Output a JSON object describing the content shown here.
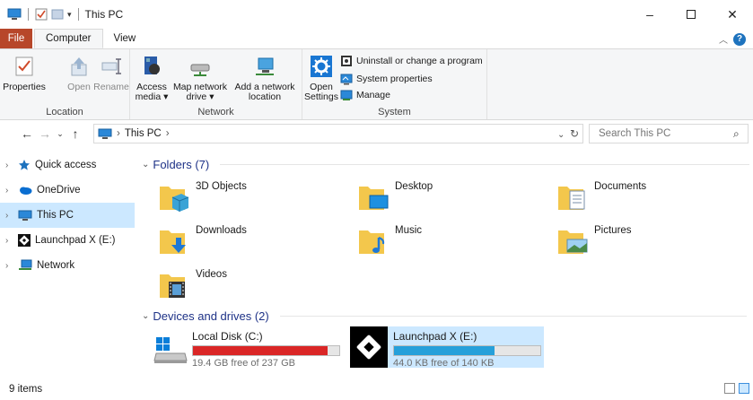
{
  "window": {
    "title": "This PC"
  },
  "ribbon_tabs": {
    "file": "File",
    "computer": "Computer",
    "view": "View"
  },
  "ribbon": {
    "location": {
      "label": "Location",
      "properties": "Properties",
      "open": "Open",
      "rename": "Rename"
    },
    "network": {
      "label": "Network",
      "access_media_1": "Access",
      "access_media_2": "media ▾",
      "map_drive_1": "Map network",
      "map_drive_2": "drive ▾",
      "add_location_1": "Add a network",
      "add_location_2": "location"
    },
    "system": {
      "label": "System",
      "open_settings_1": "Open",
      "open_settings_2": "Settings",
      "uninstall": "Uninstall or change a program",
      "system_properties": "System properties",
      "manage": "Manage"
    }
  },
  "address": {
    "crumb": "This PC",
    "chevron": "›"
  },
  "search": {
    "placeholder": "Search This PC"
  },
  "nav_pane": {
    "items": [
      {
        "label": "Quick access"
      },
      {
        "label": "OneDrive"
      },
      {
        "label": "This PC"
      },
      {
        "label": "Launchpad X (E:)"
      },
      {
        "label": "Network"
      }
    ]
  },
  "folders_section": {
    "title": "Folders (7)"
  },
  "folders": [
    "3D Objects",
    "Desktop",
    "Documents",
    "Downloads",
    "Music",
    "Pictures",
    "Videos"
  ],
  "drives_section": {
    "title": "Devices and drives (2)"
  },
  "drives": [
    {
      "name": "Local Disk (C:)",
      "free_text": "19.4 GB free of 237 GB",
      "used_fraction": 0.918,
      "bar_color": "#da2626"
    },
    {
      "name": "Launchpad X (E:)",
      "free_text": "44.0 KB free of 140 KB",
      "used_fraction": 0.686,
      "bar_color": "#26a0da"
    }
  ],
  "status": {
    "items": "9 items"
  },
  "colors": {
    "accent_file_tab": "#b7472a",
    "selection": "#cce8ff",
    "section_text": "#1e3287"
  }
}
